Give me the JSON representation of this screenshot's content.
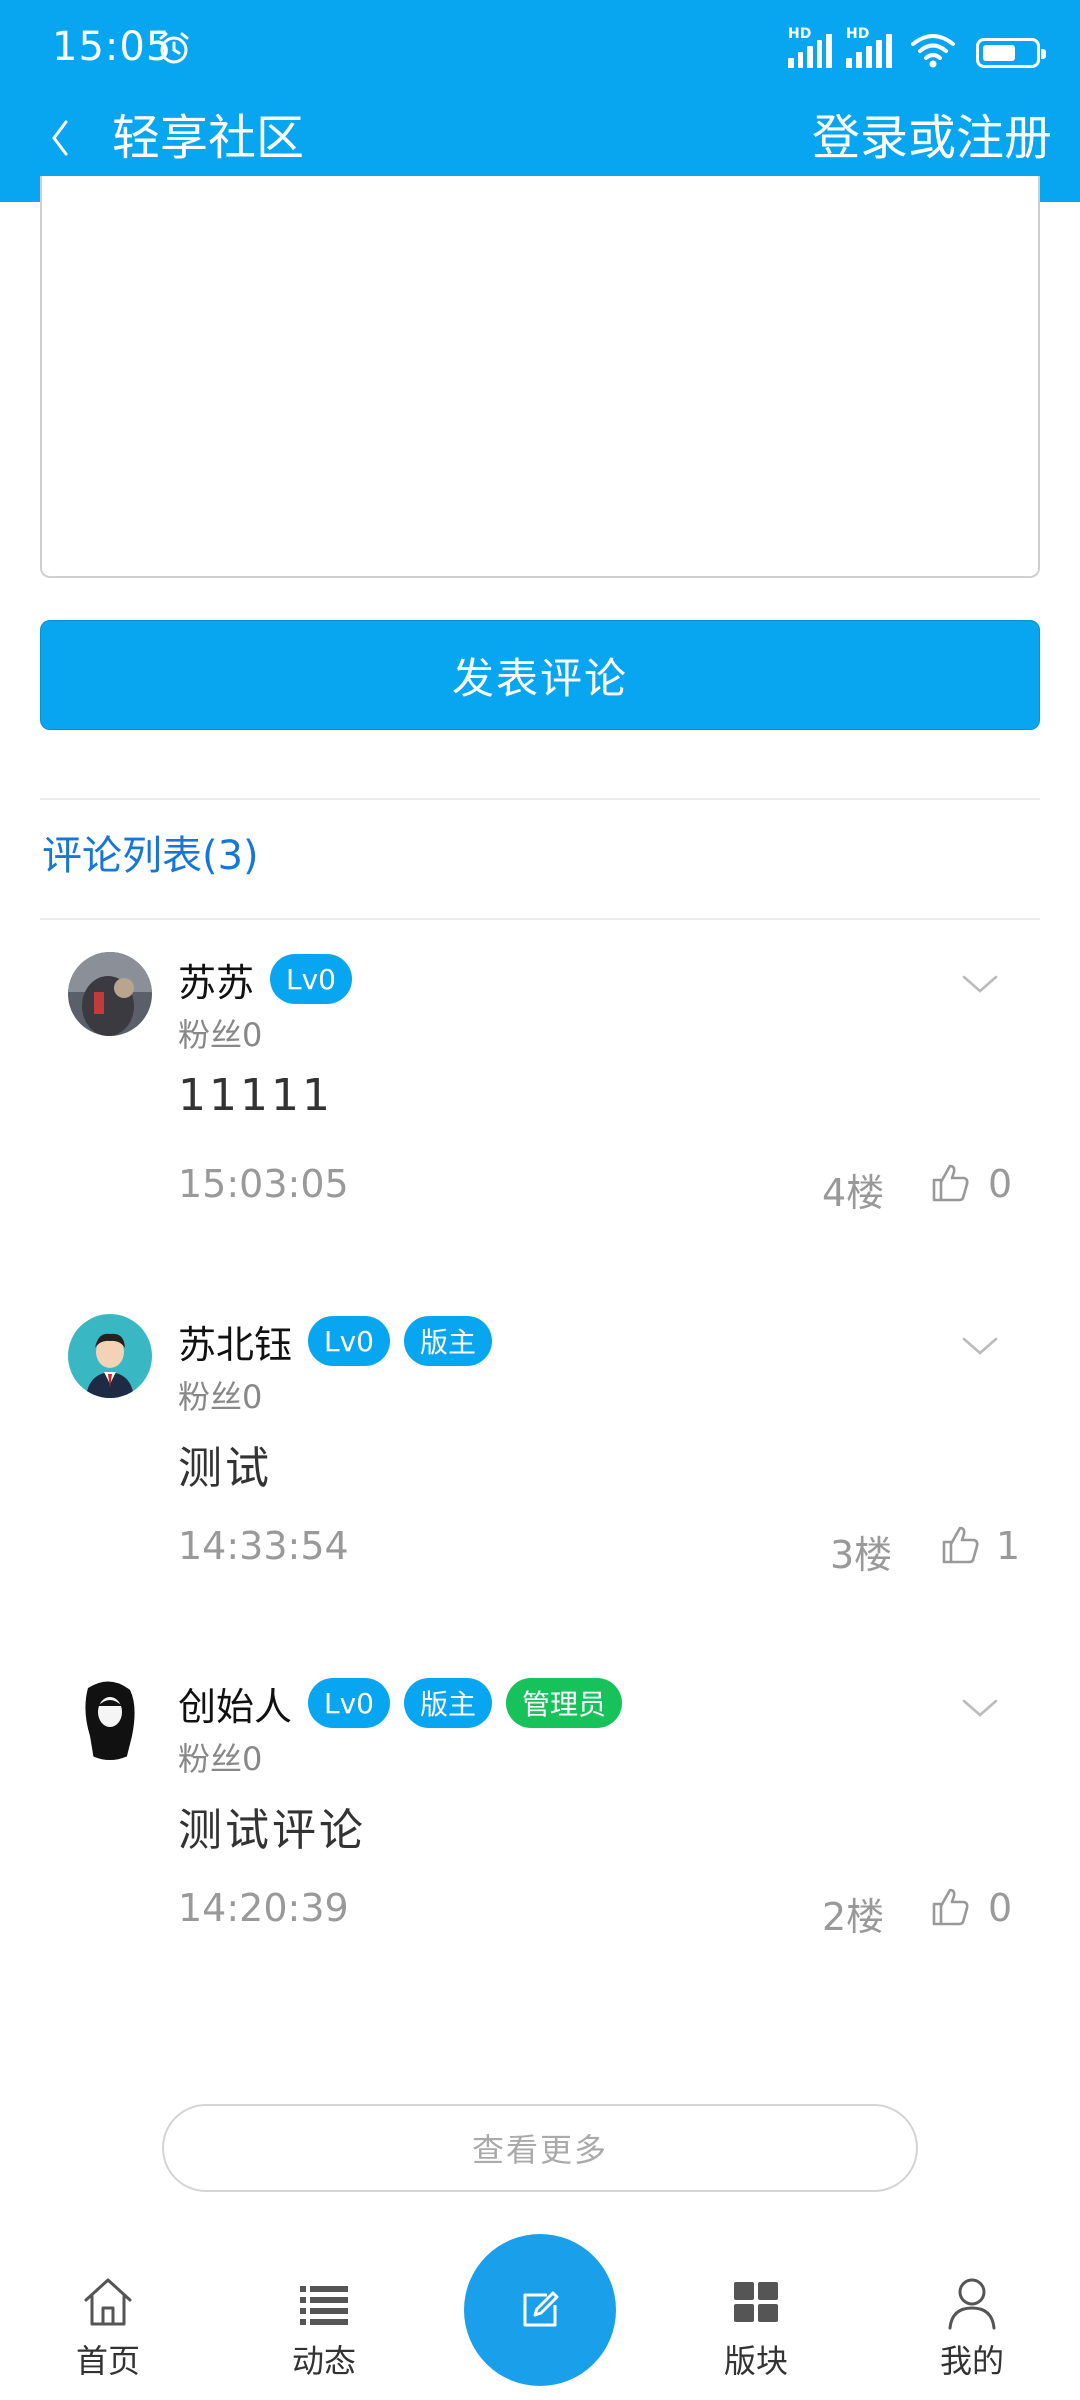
{
  "status_bar": {
    "time": "15:05",
    "network": "HD"
  },
  "header": {
    "title": "轻享社区",
    "login": "登录或注册"
  },
  "comment_form": {
    "submit_label": "发表评论"
  },
  "comments_section": {
    "title": "评论列表(3)",
    "comments": [
      {
        "name": "苏苏",
        "badges": [
          "Lv0"
        ],
        "fans": "粉丝0",
        "content": "11111",
        "time": "15:03:05",
        "floor": "4楼",
        "likes": "0"
      },
      {
        "name": "苏北钰",
        "badges": [
          "Lv0",
          "版主"
        ],
        "fans": "粉丝0",
        "content": "测试",
        "time": "14:33:54",
        "floor": "3楼",
        "likes": "1"
      },
      {
        "name": "创始人",
        "badges": [
          "Lv0",
          "版主",
          "管理员"
        ],
        "fans": "粉丝0",
        "content": "测试评论",
        "time": "14:20:39",
        "floor": "2楼",
        "likes": "0"
      }
    ],
    "more_label": "查看更多"
  },
  "bottom_nav": {
    "items": [
      {
        "label": "首页",
        "icon": "home-icon"
      },
      {
        "label": "动态",
        "icon": "list-icon"
      },
      {
        "label": "",
        "icon": "edit-icon"
      },
      {
        "label": "版块",
        "icon": "grid-icon"
      },
      {
        "label": "我的",
        "icon": "user-icon"
      }
    ]
  },
  "colors": {
    "primary": "#08a6f0",
    "admin_badge": "#17c25a",
    "link": "#1677d8"
  }
}
